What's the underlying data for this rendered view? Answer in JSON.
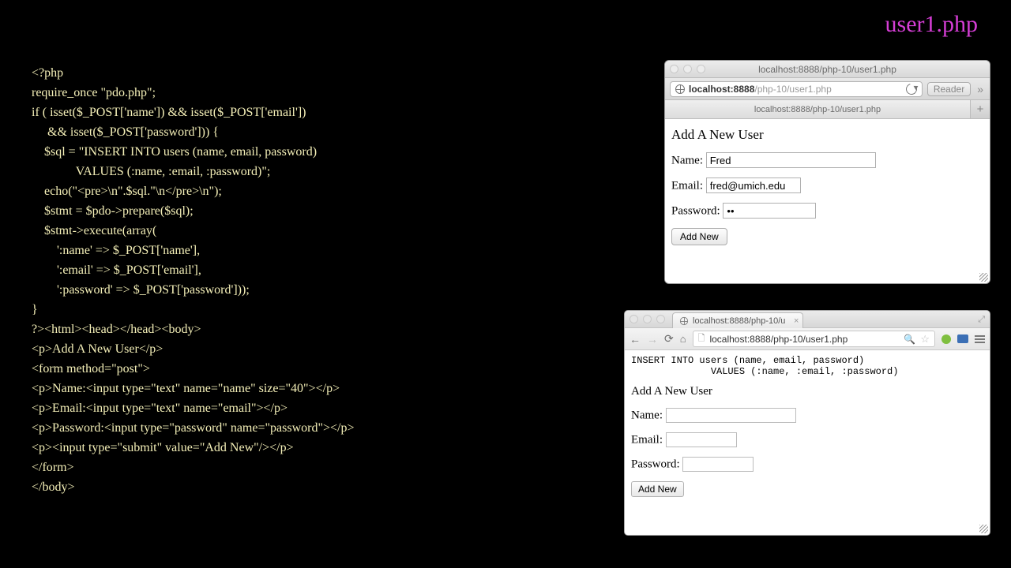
{
  "slide": {
    "title": "user1.php"
  },
  "code": "<?php\nrequire_once \"pdo.php\";\nif ( isset($_POST['name']) && isset($_POST['email'])\n     && isset($_POST['password'])) {\n    $sql = \"INSERT INTO users (name, email, password)\n              VALUES (:name, :email, :password)\";\n    echo(\"<pre>\\n\".$sql.\"\\n</pre>\\n\");\n    $stmt = $pdo->prepare($sql);\n    $stmt->execute(array(\n        ':name' => $_POST['name'],\n        ':email' => $_POST['email'],\n        ':password' => $_POST['password']));\n}\n?><html><head></head><body>\n<p>Add A New User</p>\n<form method=\"post\">\n<p>Name:<input type=\"text\" name=\"name\" size=\"40\"></p>\n<p>Email:<input type=\"text\" name=\"email\"></p>\n<p>Password:<input type=\"password\" name=\"password\"></p>\n<p><input type=\"submit\" value=\"Add New\"/></p>\n</form>\n</body>",
  "safari": {
    "window_title": "localhost:8888/php-10/user1.php",
    "url_host": "localhost:8888",
    "url_path": "/php-10/user1.php",
    "reader": "Reader",
    "tab": "localhost:8888/php-10/user1.php",
    "page": {
      "heading": "Add A New User",
      "name_label": "Name:",
      "name_value": "Fred",
      "email_label": "Email:",
      "email_value": "fred@umich.edu",
      "password_label": "Password:",
      "password_value": "••",
      "submit": "Add New"
    }
  },
  "chrome": {
    "tab": "localhost:8888/php-10/u",
    "url_prefix": "localhost:8888",
    "url_path": "/php-10/user1.php",
    "sql_echo": "INSERT INTO users (name, email, password)\n              VALUES (:name, :email, :password)",
    "page": {
      "heading": "Add A New User",
      "name_label": "Name:",
      "email_label": "Email:",
      "password_label": "Password:",
      "submit": "Add New"
    }
  }
}
